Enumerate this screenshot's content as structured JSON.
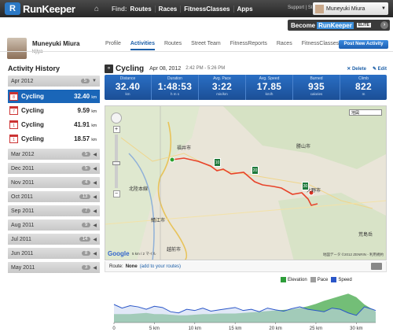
{
  "brand": {
    "name": "RunKeeper",
    "logo_letter": "R"
  },
  "nav": {
    "find_label": "Find:",
    "links": [
      "Routes",
      "Races",
      "FitnessClasses",
      "Apps"
    ]
  },
  "top_links": "Support | Store",
  "user": {
    "name": "Muneyuki Miura"
  },
  "elite": {
    "prefix": "Become",
    "brand": "RunKeeper",
    "badge": "ELITE"
  },
  "profile": {
    "name": "Muneyuki Miura",
    "subtitle": "kijiya"
  },
  "tabs": [
    {
      "label": "Profile",
      "active": false
    },
    {
      "label": "Activities",
      "active": true
    },
    {
      "label": "Routes",
      "active": false
    },
    {
      "label": "Street Team",
      "active": false
    },
    {
      "label": "FitnessReports",
      "active": false
    },
    {
      "label": "Races",
      "active": false
    },
    {
      "label": "FitnessClasses",
      "active": false
    }
  ],
  "post_button": "Post New Activity",
  "history": {
    "title": "Activity History",
    "current_month": {
      "label": "Apr 2012",
      "count": "5"
    },
    "activities": [
      {
        "name": "Cycling",
        "distance": "32.40",
        "unit": "km",
        "selected": true,
        "day": "8"
      },
      {
        "name": "Cycling",
        "distance": "9.59",
        "unit": "km",
        "selected": false,
        "day": "7"
      },
      {
        "name": "Cycling",
        "distance": "41.91",
        "unit": "km",
        "selected": false,
        "day": "1"
      },
      {
        "name": "Cycling",
        "distance": "18.57",
        "unit": "km",
        "selected": false,
        "day": "1"
      }
    ],
    "months": [
      {
        "label": "Mar 2012",
        "count": "5"
      },
      {
        "label": "Dec 2011",
        "count": "5"
      },
      {
        "label": "Nov 2011",
        "count": "4"
      },
      {
        "label": "Oct 2011",
        "count": "13"
      },
      {
        "label": "Sep 2011",
        "count": "7"
      },
      {
        "label": "Aug 2011",
        "count": "9"
      },
      {
        "label": "Jul 2011",
        "count": "14"
      },
      {
        "label": "Jun 2011",
        "count": "8"
      },
      {
        "label": "May 2011",
        "count": "3"
      }
    ]
  },
  "activity": {
    "type": "Cycling",
    "date": "Apr 08, 2012",
    "time": "2:42 PM - 5:26 PM",
    "delete_label": "Delete",
    "edit_label": "Edit",
    "stats": [
      {
        "label": "Distance",
        "value": "32.40",
        "unit": "km"
      },
      {
        "label": "Duration",
        "value": "1:48:53",
        "unit": "h  m  s"
      },
      {
        "label": "Avg. Pace",
        "value": "3:22",
        "unit": "min/km"
      },
      {
        "label": "Avg. Speed",
        "value": "17.85",
        "unit": "km/h"
      },
      {
        "label": "Burned",
        "value": "935",
        "unit": "calories"
      },
      {
        "label": "Climb",
        "value": "822",
        "unit": "m"
      }
    ]
  },
  "map": {
    "type_select": "地図",
    "labels": [
      "福井市",
      "越前市",
      "鯖江市",
      "勝山市",
      "大野市",
      "北陸本線",
      "荒島岳"
    ],
    "markers": [
      "10",
      "20",
      "30"
    ],
    "copyright": "地図データ ©2012 ZENRIN - 利用規約",
    "google": "Google",
    "scale_km": "5 km",
    "scale_mi": "2 マイル"
  },
  "route": {
    "label": "Route:",
    "value": "None",
    "link": "(add to your routes)"
  },
  "legend": [
    {
      "label": "Elevation",
      "color": "#2e9e3a"
    },
    {
      "label": "Pace",
      "color": "#9e9e9e"
    },
    {
      "label": "Speed",
      "color": "#2a56c8"
    }
  ],
  "chart_data": {
    "type": "area",
    "x": [
      0,
      1,
      2,
      3,
      4,
      5,
      6,
      7,
      8,
      9,
      10,
      11,
      12,
      13,
      14,
      15,
      16,
      17,
      18,
      19,
      20,
      21,
      22,
      23,
      24,
      25,
      26,
      27,
      28,
      29,
      30,
      31,
      32,
      32.4
    ],
    "xticks": [
      "0",
      "5 km",
      "10 km",
      "15 km",
      "20 km",
      "25 km",
      "30 km"
    ],
    "series": [
      {
        "name": "Elevation",
        "values": [
          14,
          14,
          14,
          15,
          16,
          14,
          14,
          13,
          12,
          12,
          13,
          14,
          14,
          15,
          15,
          15,
          16,
          17,
          18,
          19,
          20,
          21,
          22,
          24,
          27,
          31,
          36,
          40,
          44,
          48,
          42,
          30,
          22,
          18
        ]
      },
      {
        "name": "Speed",
        "values": [
          30,
          24,
          28,
          26,
          22,
          27,
          25,
          18,
          16,
          22,
          20,
          24,
          19,
          21,
          23,
          25,
          20,
          22,
          18,
          24,
          21,
          19,
          23,
          26,
          22,
          20,
          18,
          24,
          22,
          16,
          12,
          26,
          22,
          20
        ]
      }
    ]
  }
}
